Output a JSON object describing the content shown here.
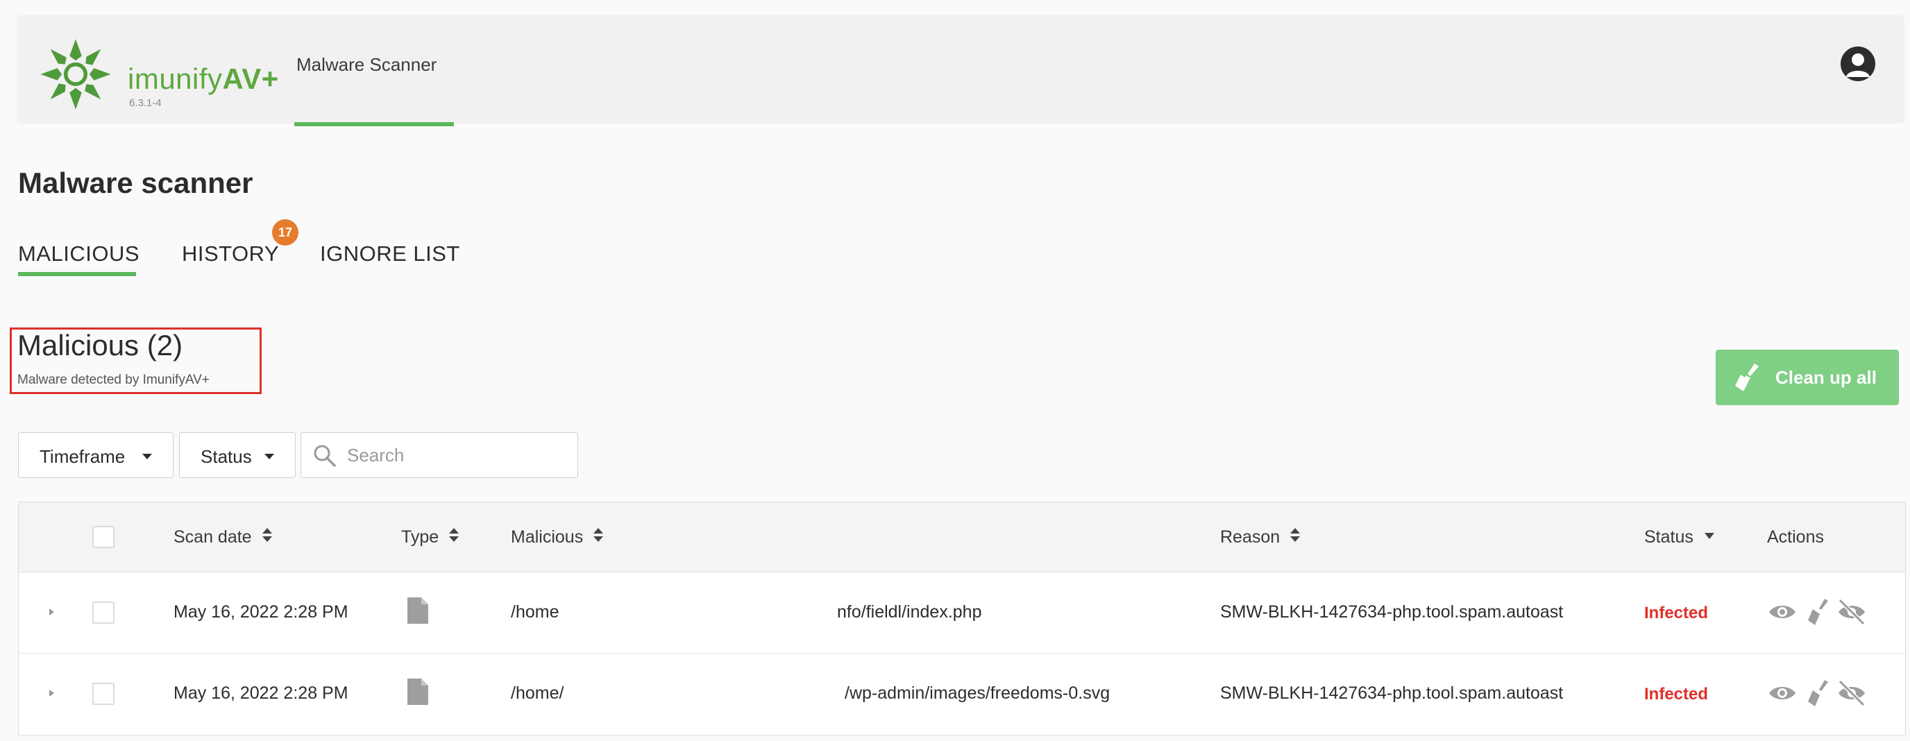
{
  "header": {
    "brand_prefix": "imunify",
    "brand_suffix": "AV+",
    "version": "6.3.1-4",
    "nav_item": "Malware Scanner",
    "brand_color": "#5da840",
    "accent_color": "#5cb85c"
  },
  "page": {
    "title": "Malware scanner"
  },
  "tabs": [
    {
      "label": "MALICIOUS",
      "active": true
    },
    {
      "label": "HISTORY",
      "badge": "17"
    },
    {
      "label": "IGNORE LIST"
    }
  ],
  "section": {
    "title": "Malicious (2)",
    "subtitle": "Malware detected by ImunifyAV+"
  },
  "actions": {
    "cleanup_label": "Clean up all",
    "cleanup_icon": "broom-icon"
  },
  "filters": {
    "timeframe_label": "Timeframe",
    "status_label": "Status",
    "search_placeholder": "Search"
  },
  "table": {
    "columns": [
      "Scan date",
      "Type",
      "Malicious",
      "Reason",
      "Status",
      "Actions"
    ],
    "rows": [
      {
        "scan_date": "May 16, 2022 2:28 PM",
        "type": "file-icon",
        "path_start": "/home",
        "path_end": "nfo/fieldl/index.php",
        "reason": "SMW-BLKH-1427634-php.tool.spam.autoast",
        "status": "Infected"
      },
      {
        "scan_date": "May 16, 2022 2:28 PM",
        "type": "file-icon",
        "path_start": "/home/",
        "path_end": "/wp-admin/images/freedoms-0.svg",
        "reason": "SMW-BLKH-1427634-php.tool.spam.autoast",
        "status": "Infected"
      }
    ],
    "row_actions": [
      "eye-icon",
      "broom-icon",
      "eye-slash-icon"
    ],
    "status_color": "#e0302a"
  }
}
